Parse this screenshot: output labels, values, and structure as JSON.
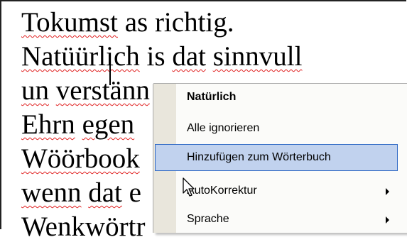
{
  "document": {
    "lines": [
      {
        "w1": "Tokumst",
        "r1": " as richtig."
      },
      {
        "w1": "Natüür",
        "w2": "lich",
        "r1": " is ",
        "w3": "dat",
        "r2": " ",
        "w4": "sinnvull"
      },
      {
        "w1": "un",
        "r1": " ",
        "w2": "verstänn"
      },
      {
        "w1": "Ehrn",
        "r1": " ",
        "w2": "egen"
      },
      {
        "w1": "Wöörbook"
      },
      {
        "w1": "wenn",
        "r1": " ",
        "w2": "dat",
        "r2": " e"
      },
      {
        "w1": "Wenkwörtr"
      }
    ]
  },
  "context_menu": {
    "items": [
      {
        "label": "Natürlich"
      },
      {
        "label": "Alle ignorieren"
      },
      {
        "label": "Hinzufügen zum Wörterbuch"
      },
      {
        "label": "AutoKorrektur"
      },
      {
        "label": "Sprache"
      }
    ]
  },
  "colors": {
    "spell_squiggle": "#e02020",
    "hover_fill": "#c1d2ee",
    "hover_border": "#316ac5",
    "gutter": "#e9e6dc"
  },
  "icons": {
    "pointer": "arrow-cursor-icon",
    "submenu": "submenu-arrow-icon"
  }
}
